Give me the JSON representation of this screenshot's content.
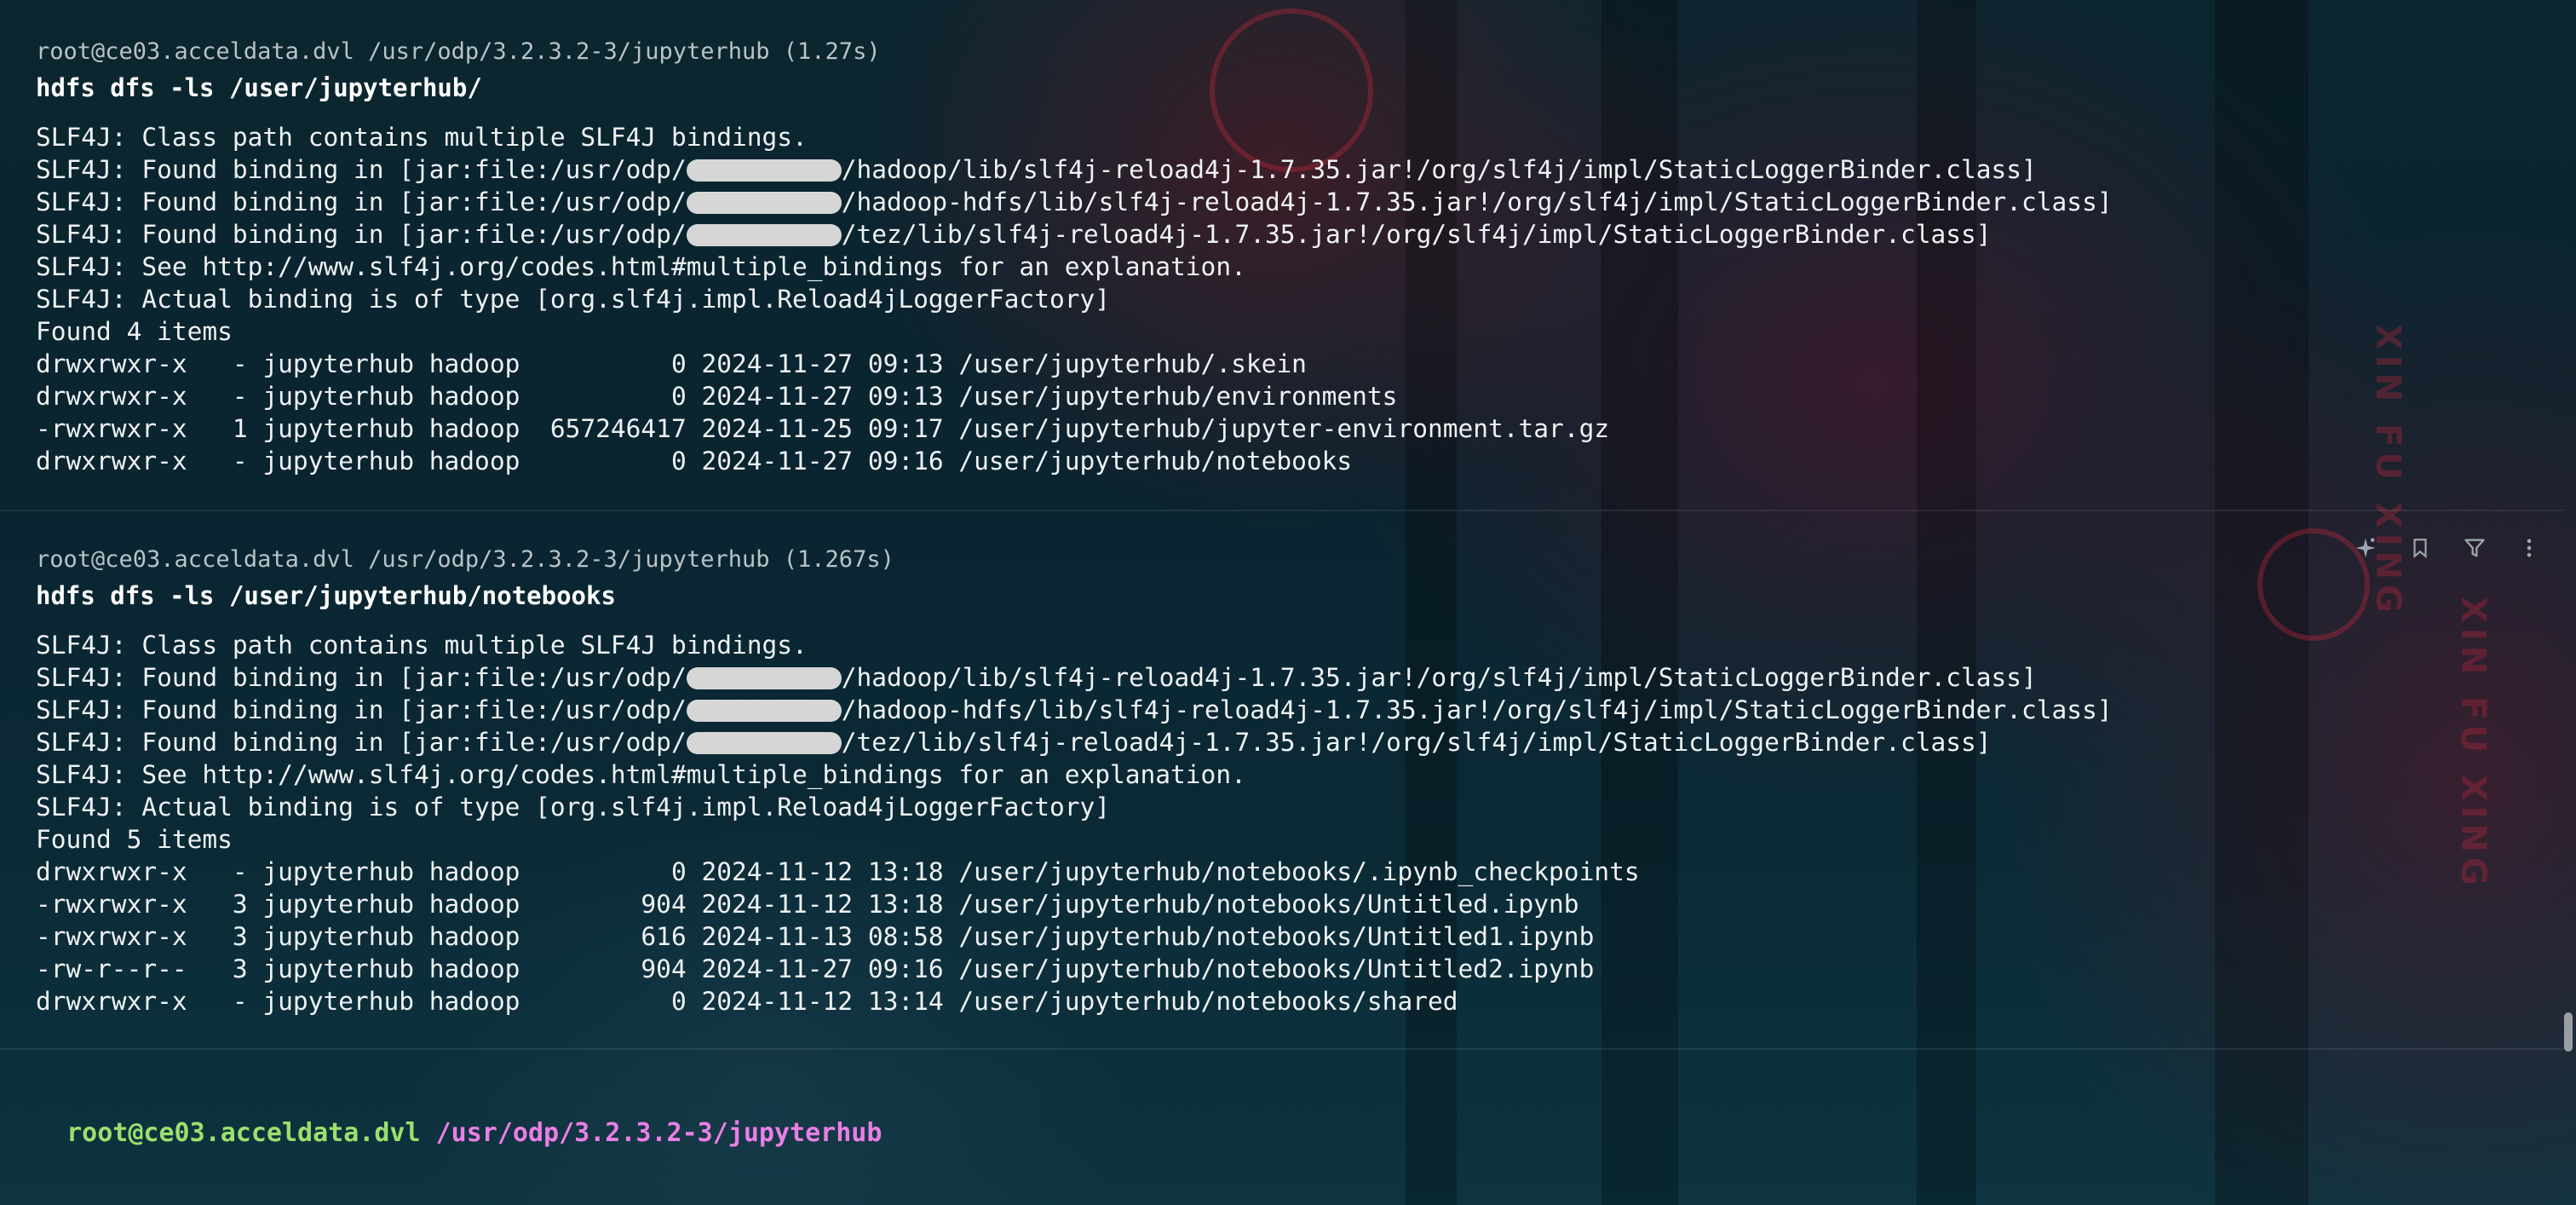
{
  "blocks": [
    {
      "header": "root@ce03.acceldata.dvl /usr/odp/3.2.3.2-3/jupyterhub (1.27s)",
      "command": "hdfs dfs -ls /user/jupyterhub/",
      "output": [
        {
          "segments": [
            "SLF4J: Class path contains multiple SLF4J bindings."
          ]
        },
        {
          "segments": [
            "SLF4J: Found binding in [jar:file:/usr/odp/",
            "/hadoop/lib/slf4j-reload4j-1.7.35.jar!/org/slf4j/impl/StaticLoggerBinder.class]"
          ]
        },
        {
          "segments": [
            "SLF4J: Found binding in [jar:file:/usr/odp/",
            "/hadoop-hdfs/lib/slf4j-reload4j-1.7.35.jar!/org/slf4j/impl/StaticLoggerBinder.class]"
          ]
        },
        {
          "segments": [
            "SLF4J: Found binding in [jar:file:/usr/odp/",
            "/tez/lib/slf4j-reload4j-1.7.35.jar!/org/slf4j/impl/StaticLoggerBinder.class]"
          ]
        },
        {
          "segments": [
            "SLF4J: See http://www.slf4j.org/codes.html#multiple_bindings for an explanation."
          ]
        },
        {
          "segments": [
            "SLF4J: Actual binding is of type [org.slf4j.impl.Reload4jLoggerFactory]"
          ]
        },
        {
          "segments": [
            "Found 4 items"
          ]
        },
        {
          "segments": [
            "drwxrwxr-x   - jupyterhub hadoop          0 2024-11-27 09:13 /user/jupyterhub/.skein"
          ]
        },
        {
          "segments": [
            "drwxrwxr-x   - jupyterhub hadoop          0 2024-11-27 09:13 /user/jupyterhub/environments"
          ]
        },
        {
          "segments": [
            "-rwxrwxr-x   1 jupyterhub hadoop  657246417 2024-11-25 09:17 /user/jupyterhub/jupyter-environment.tar.gz"
          ]
        },
        {
          "segments": [
            "drwxrwxr-x   - jupyterhub hadoop          0 2024-11-27 09:16 /user/jupyterhub/notebooks"
          ]
        }
      ]
    },
    {
      "header": "root@ce03.acceldata.dvl /usr/odp/3.2.3.2-3/jupyterhub (1.267s)",
      "command": "hdfs dfs -ls /user/jupyterhub/notebooks",
      "output": [
        {
          "segments": [
            "SLF4J: Class path contains multiple SLF4J bindings."
          ]
        },
        {
          "segments": [
            "SLF4J: Found binding in [jar:file:/usr/odp/",
            "/hadoop/lib/slf4j-reload4j-1.7.35.jar!/org/slf4j/impl/StaticLoggerBinder.class]"
          ]
        },
        {
          "segments": [
            "SLF4J: Found binding in [jar:file:/usr/odp/",
            "/hadoop-hdfs/lib/slf4j-reload4j-1.7.35.jar!/org/slf4j/impl/StaticLoggerBinder.class]"
          ]
        },
        {
          "segments": [
            "SLF4J: Found binding in [jar:file:/usr/odp/",
            "/tez/lib/slf4j-reload4j-1.7.35.jar!/org/slf4j/impl/StaticLoggerBinder.class]"
          ]
        },
        {
          "segments": [
            "SLF4J: See http://www.slf4j.org/codes.html#multiple_bindings for an explanation."
          ]
        },
        {
          "segments": [
            "SLF4J: Actual binding is of type [org.slf4j.impl.Reload4jLoggerFactory]"
          ]
        },
        {
          "segments": [
            "Found 5 items"
          ]
        },
        {
          "segments": [
            "drwxrwxr-x   - jupyterhub hadoop          0 2024-11-12 13:18 /user/jupyterhub/notebooks/.ipynb_checkpoints"
          ]
        },
        {
          "segments": [
            "-rwxrwxr-x   3 jupyterhub hadoop        904 2024-11-12 13:18 /user/jupyterhub/notebooks/Untitled.ipynb"
          ]
        },
        {
          "segments": [
            "-rwxrwxr-x   3 jupyterhub hadoop        616 2024-11-13 08:58 /user/jupyterhub/notebooks/Untitled1.ipynb"
          ]
        },
        {
          "segments": [
            "-rw-r--r--   3 jupyterhub hadoop        904 2024-11-27 09:16 /user/jupyterhub/notebooks/Untitled2.ipynb"
          ]
        },
        {
          "segments": [
            "drwxrwxr-x   - jupyterhub hadoop          0 2024-11-12 13:14 /user/jupyterhub/notebooks/shared"
          ]
        }
      ]
    }
  ],
  "block_toolbar": {
    "icons": [
      "sparkle-icon",
      "bookmark-icon",
      "filter-icon",
      "more-vertical-icon"
    ]
  },
  "prompt": {
    "host": "root@ce03.acceldata.dvl",
    "path": "/usr/odp/3.2.3.2-3/jupyterhub"
  },
  "colors": {
    "prompt_host": "#9be06c",
    "prompt_path": "#ea7fe4",
    "header_text": "#b9c3c6",
    "output_text": "#eef2f3",
    "redaction": "#d6d6d6"
  }
}
